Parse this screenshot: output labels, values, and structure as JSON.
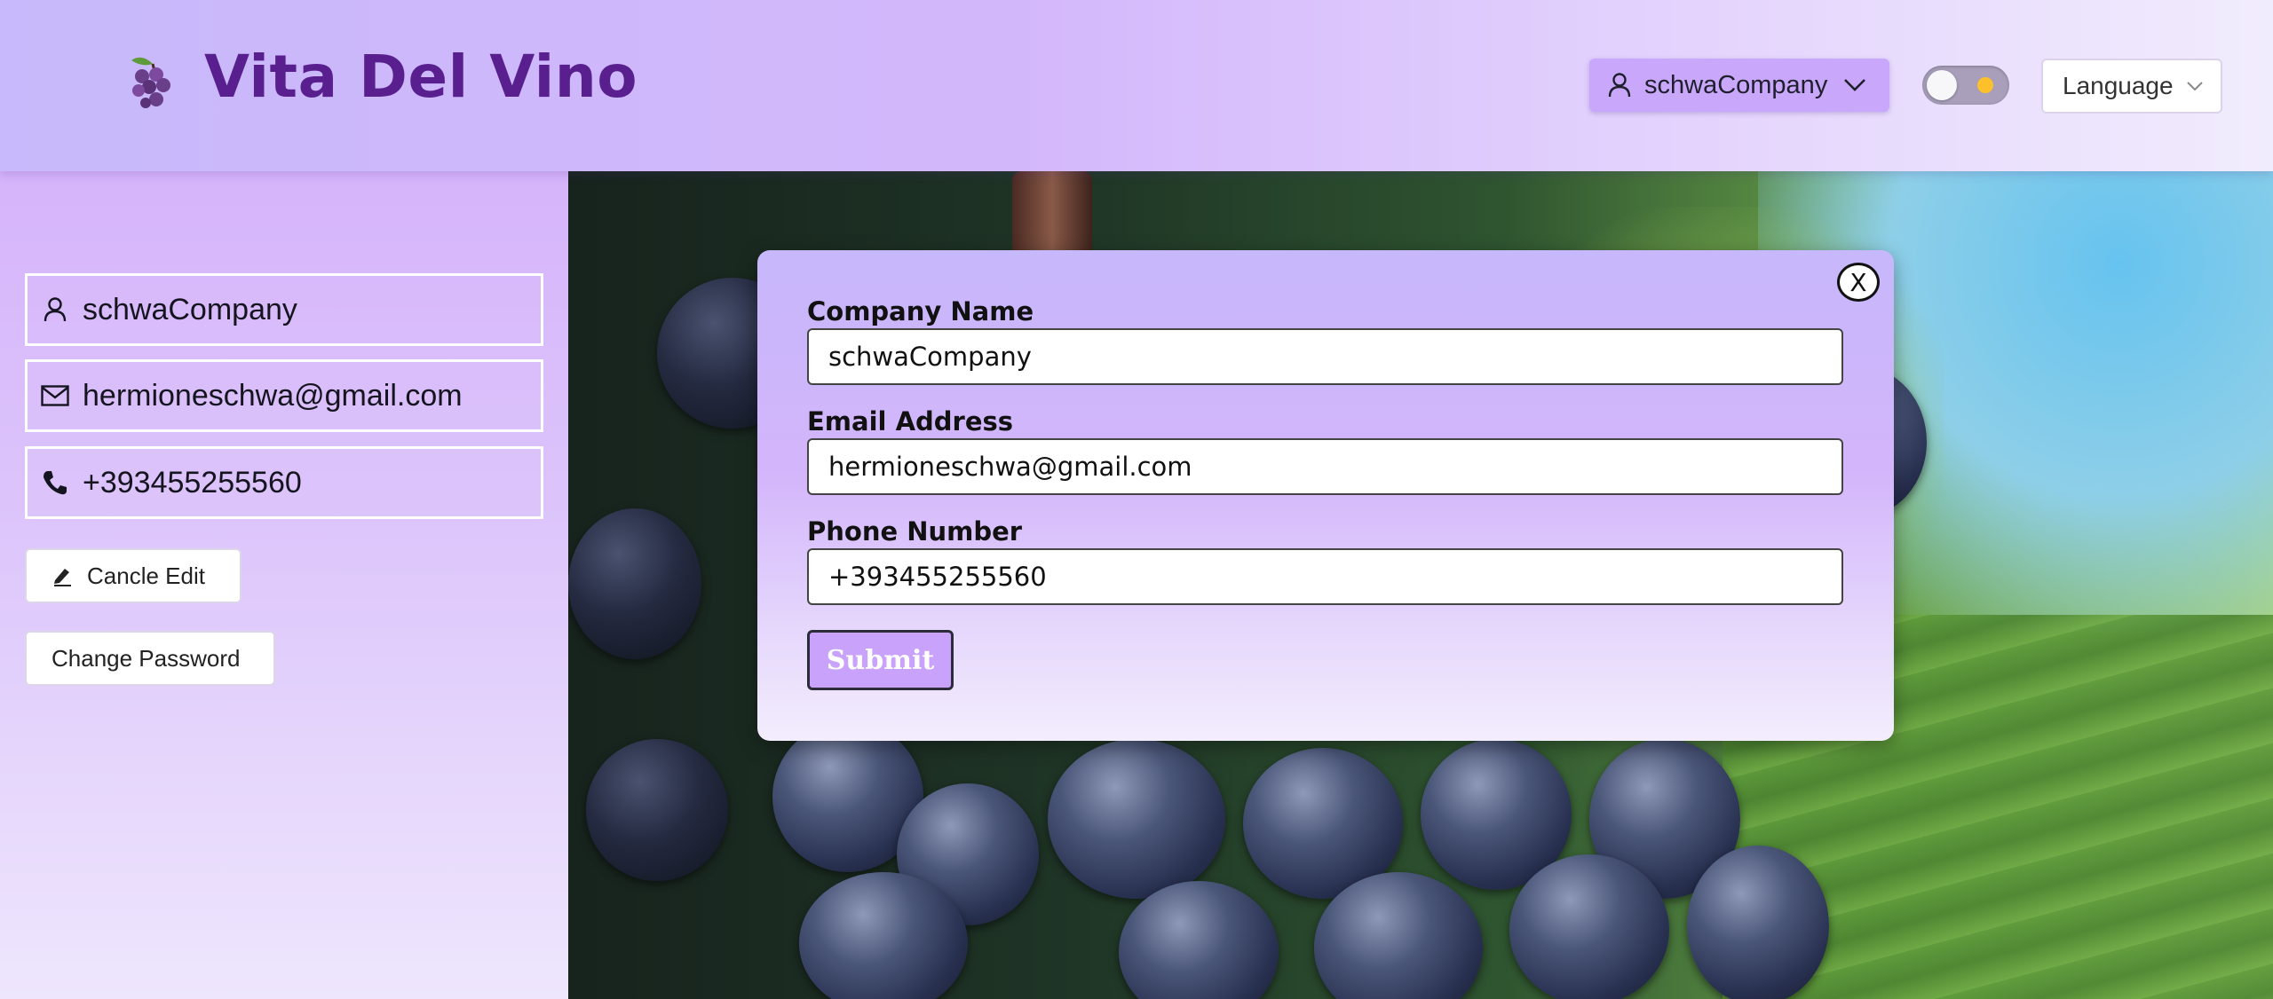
{
  "header": {
    "brand": "Vita Del Vino",
    "logo_icon": "grapes-icon",
    "user_menu": {
      "label": "schwaCompany",
      "icon": "user-icon",
      "chevron": "chevron-down-icon"
    },
    "theme_toggle": {
      "state": "off"
    },
    "language": {
      "label": "Language",
      "chevron": "chevron-down-icon"
    }
  },
  "sidebar": {
    "username": "schwaCompany",
    "email": "hermioneschwa@gmail.com",
    "phone": "+393455255560",
    "cancel_edit_label": "Cancle Edit",
    "change_password_label": "Change Password"
  },
  "modal": {
    "close_label": "X",
    "company_name_label": "Company Name",
    "company_name_value": "schwaCompany",
    "email_label": "Email Address",
    "email_value": "hermioneschwa@gmail.com",
    "phone_label": "Phone Number",
    "phone_value": "+393455255560",
    "submit_label": "Submit"
  },
  "colors": {
    "brand": "#5a1f8f",
    "accent": "#c9a3fb",
    "toggle_sun": "#fcc12a"
  }
}
